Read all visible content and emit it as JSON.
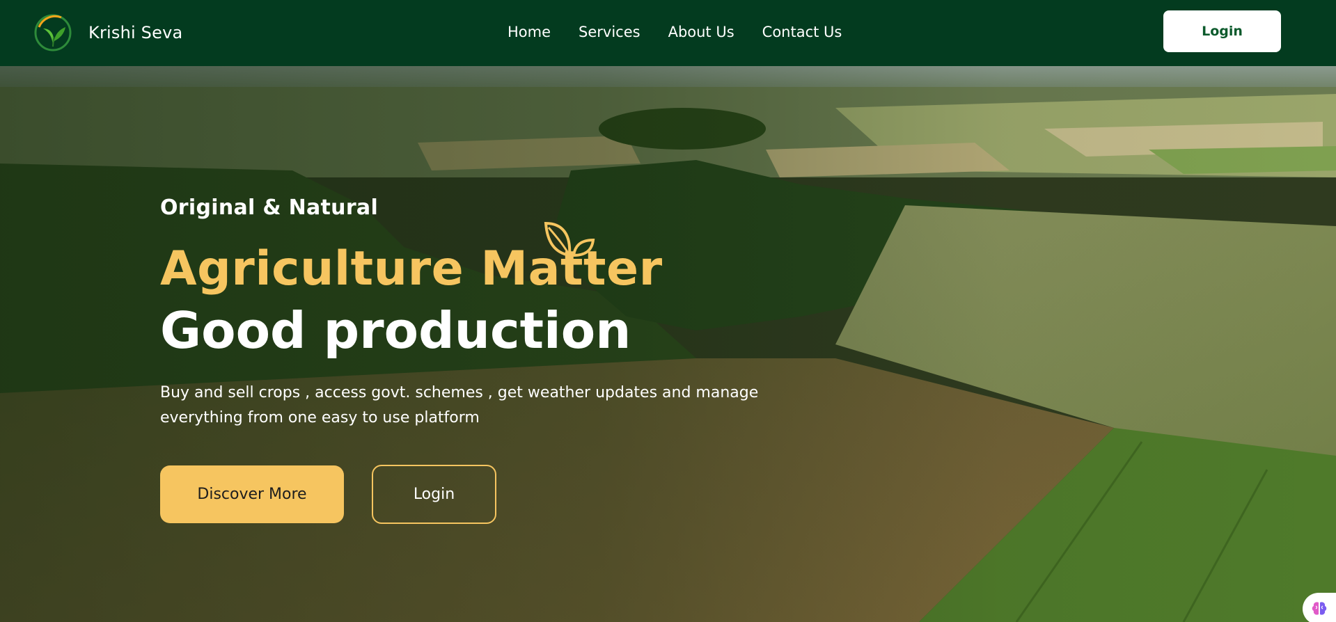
{
  "navbar": {
    "brand_name": "Krishi Seva",
    "logo_icon": "sprout-logo-icon",
    "links": [
      {
        "label": "Home"
      },
      {
        "label": "Services"
      },
      {
        "label": "About Us"
      },
      {
        "label": "Contact Us"
      }
    ],
    "login_label": "Login"
  },
  "hero": {
    "eyebrow": "Original & Natural",
    "headline_accent": "Agriculture Matter",
    "headline_main": "Good production",
    "description": "Buy and sell crops , access govt. schemes , get weather updates and manage everything from one easy to use platform",
    "discover_label": "Discover More",
    "login_label": "Login",
    "decor_icon": "leaf-sprout-icon"
  },
  "widget": {
    "icon": "brain-icon"
  },
  "colors": {
    "navbar_bg": "#033b1f",
    "accent_gold": "#f6c560",
    "login_text": "#0c5a2c"
  }
}
